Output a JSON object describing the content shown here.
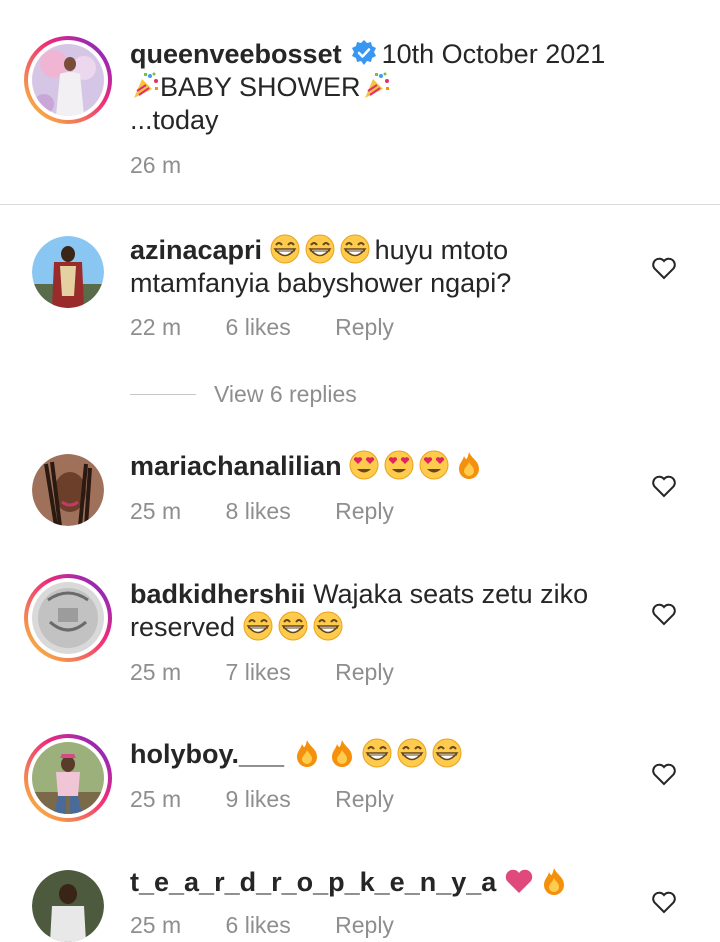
{
  "caption": {
    "username": "queenveebosset",
    "title_text": "10th October 2021",
    "line2": "BABY SHOWER",
    "line3": "...today",
    "time": "26 m"
  },
  "thread": {
    "view_replies": "View 6 replies"
  },
  "comments": [
    {
      "username": "azinacapri",
      "text_a": "huyu mtoto",
      "text_b": "mtamfanyia babyshower ngapi?",
      "time": "22 m",
      "likes": "6 likes",
      "reply": "Reply"
    },
    {
      "username": "mariachanalilian",
      "time": "25 m",
      "likes": "8 likes",
      "reply": "Reply"
    },
    {
      "username": "badkidhershii",
      "text_a": "Wajaka seats zetu ziko",
      "text_b": "reserved",
      "time": "25 m",
      "likes": "7 likes",
      "reply": "Reply"
    },
    {
      "username": "holyboy.___",
      "time": "25 m",
      "likes": "9 likes",
      "reply": "Reply"
    },
    {
      "username": "t_e_a_r_d_r_o_p_k_e_n_y_a",
      "time": "25 m",
      "likes": "6 likes",
      "reply": "Reply"
    }
  ],
  "icons": {
    "verified": "verified-badge-icon",
    "heart": "heart-outline-icon",
    "grin": "grinning-face-icon",
    "heart_eyes": "heart-eyes-icon",
    "fire": "fire-icon",
    "pink_heart": "pink-heart-icon",
    "confetti": "confetti-ball-icon"
  },
  "colors": {
    "verified_blue": "#3897f0",
    "meta_gray": "#8e8e8e",
    "text": "#262626"
  }
}
